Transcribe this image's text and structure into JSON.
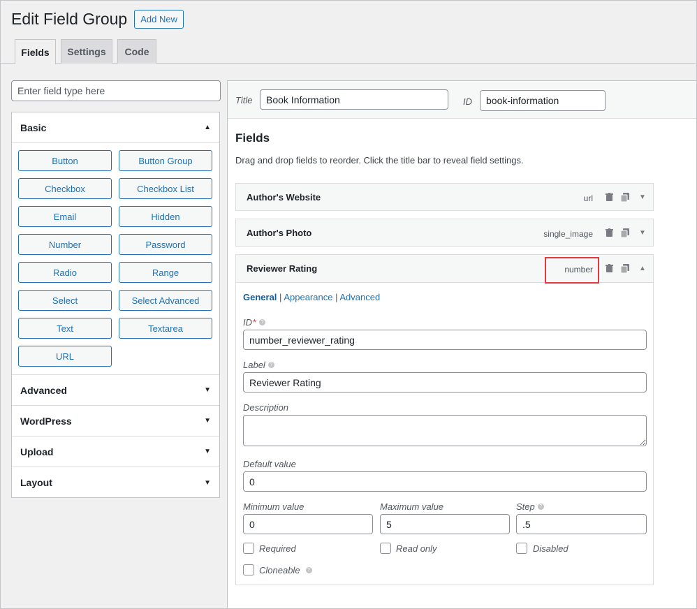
{
  "header": {
    "title": "Edit Field Group",
    "add_new": "Add New"
  },
  "tabs": [
    {
      "label": "Fields"
    },
    {
      "label": "Settings"
    },
    {
      "label": "Code"
    }
  ],
  "sidebar": {
    "search_placeholder": "Enter field type here",
    "sections": [
      {
        "label": "Basic"
      },
      {
        "label": "Advanced"
      },
      {
        "label": "WordPress"
      },
      {
        "label": "Upload"
      },
      {
        "label": "Layout"
      }
    ],
    "field_types": [
      "Button",
      "Button Group",
      "Checkbox",
      "Checkbox List",
      "Email",
      "Hidden",
      "Number",
      "Password",
      "Radio",
      "Range",
      "Select",
      "Select Advanced",
      "Text",
      "Textarea",
      "URL"
    ]
  },
  "group": {
    "title_label": "Title",
    "title_value": "Book Information",
    "id_label": "ID",
    "id_value": "book-information"
  },
  "fields_section": {
    "heading": "Fields",
    "description": "Drag and drop fields to reorder. Click the title bar to reveal field settings.",
    "items": [
      {
        "name": "Author's Website",
        "type": "url"
      },
      {
        "name": "Author's Photo",
        "type": "single_image"
      },
      {
        "name": "Reviewer Rating",
        "type": "number"
      }
    ]
  },
  "field_settings": {
    "subtabs": [
      "General",
      "Appearance",
      "Advanced"
    ],
    "id_label": "ID",
    "required_mark": "*",
    "id_value": "number_reviewer_rating",
    "label_label": "Label",
    "label_value": "Reviewer Rating",
    "description_label": "Description",
    "default_label": "Default value",
    "default_value": "0",
    "min_label": "Minimum value",
    "min_value": "0",
    "max_label": "Maximum value",
    "max_value": "5",
    "step_label": "Step",
    "step_value": ".5",
    "checkboxes": [
      "Required",
      "Read only",
      "Disabled",
      "Cloneable"
    ]
  }
}
